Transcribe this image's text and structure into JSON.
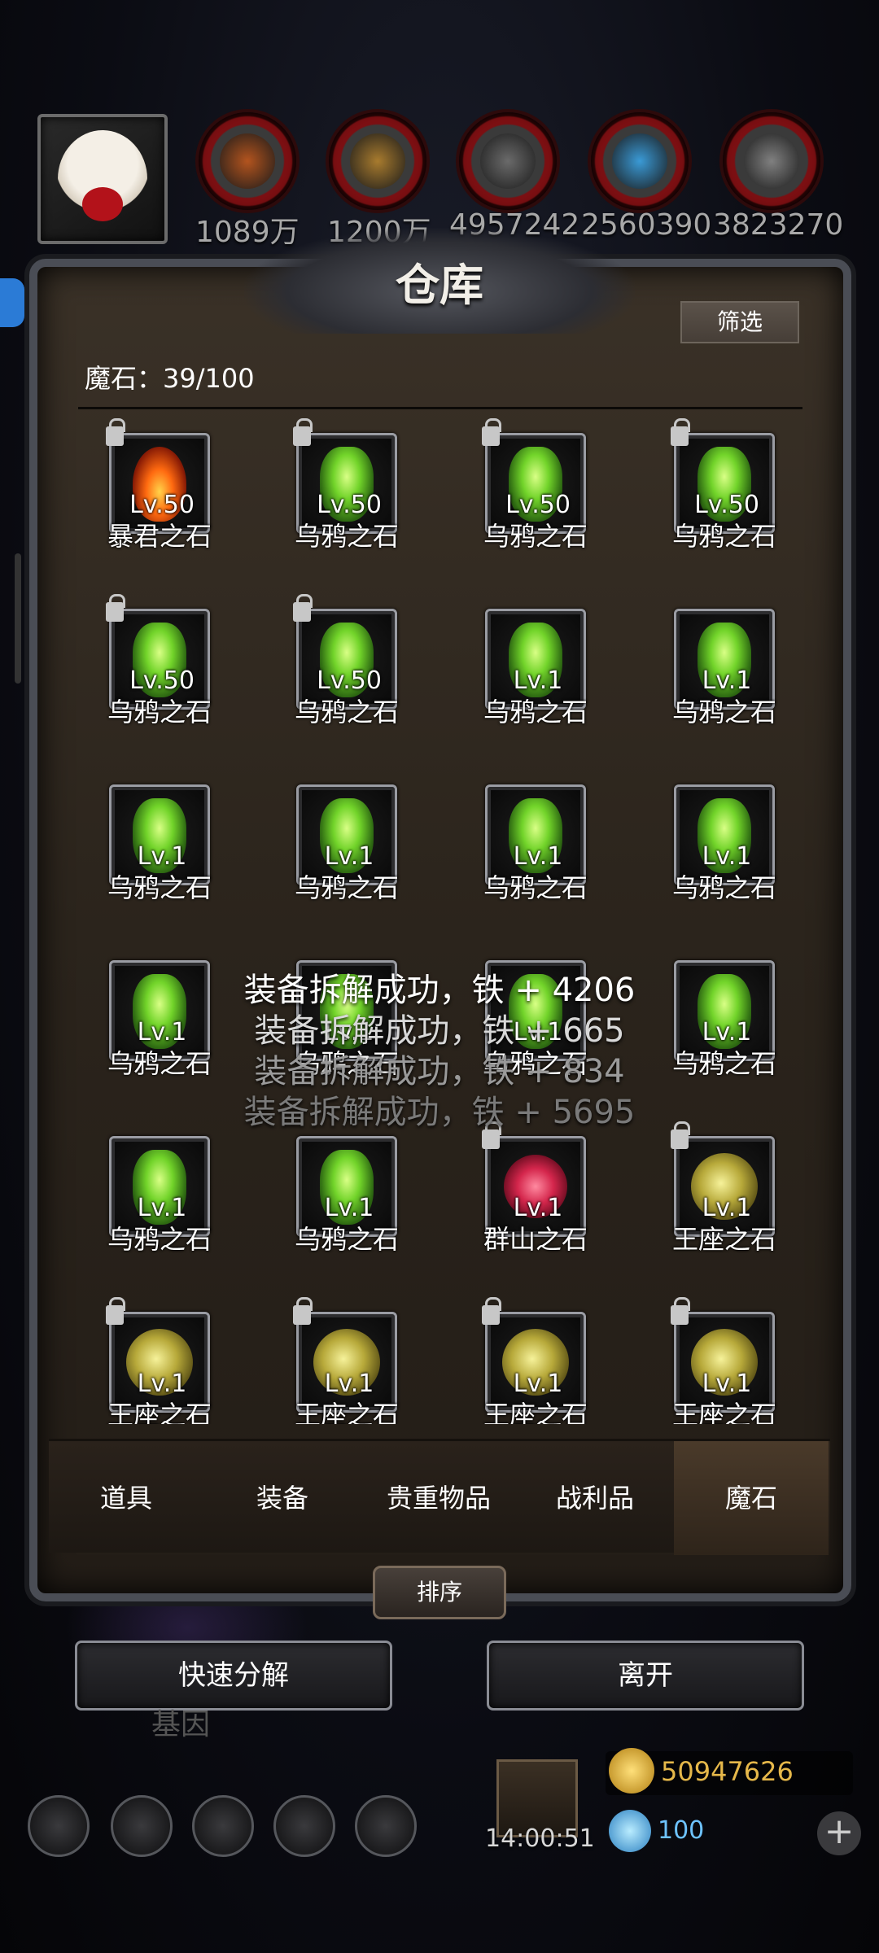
{
  "resources": [
    {
      "name": "meat",
      "value": "1089万",
      "color": "#b3541e"
    },
    {
      "name": "wood",
      "value": "1200万",
      "color": "#a87b2e"
    },
    {
      "name": "stone",
      "value": "4957242",
      "color": "#6a6a6a"
    },
    {
      "name": "crystal",
      "value": "2560390",
      "color": "#3a9ad6"
    },
    {
      "name": "iron",
      "value": "3823270",
      "color": "#808080"
    }
  ],
  "panel": {
    "title": "仓库",
    "filter_label": "筛选",
    "count_label": "魔石：39/100"
  },
  "items": [
    {
      "name": "暴君之石",
      "level": "Lv.50",
      "type": "tyrant",
      "locked": true
    },
    {
      "name": "乌鸦之石",
      "level": "Lv.50",
      "type": "crow",
      "locked": true
    },
    {
      "name": "乌鸦之石",
      "level": "Lv.50",
      "type": "crow",
      "locked": true
    },
    {
      "name": "乌鸦之石",
      "level": "Lv.50",
      "type": "crow",
      "locked": true
    },
    {
      "name": "乌鸦之石",
      "level": "Lv.50",
      "type": "crow",
      "locked": true
    },
    {
      "name": "乌鸦之石",
      "level": "Lv.50",
      "type": "crow",
      "locked": true
    },
    {
      "name": "乌鸦之石",
      "level": "Lv.1",
      "type": "crow",
      "locked": false
    },
    {
      "name": "乌鸦之石",
      "level": "Lv.1",
      "type": "crow",
      "locked": false
    },
    {
      "name": "乌鸦之石",
      "level": "Lv.1",
      "type": "crow",
      "locked": false
    },
    {
      "name": "乌鸦之石",
      "level": "Lv.1",
      "type": "crow",
      "locked": false
    },
    {
      "name": "乌鸦之石",
      "level": "Lv.1",
      "type": "crow",
      "locked": false
    },
    {
      "name": "乌鸦之石",
      "level": "Lv.1",
      "type": "crow",
      "locked": false
    },
    {
      "name": "乌鸦之石",
      "level": "Lv.1",
      "type": "crow",
      "locked": false
    },
    {
      "name": "乌鸦之石",
      "level": "Lv.1",
      "type": "crow",
      "locked": false
    },
    {
      "name": "乌鸦之石",
      "level": "Lv.1",
      "type": "crow",
      "locked": false
    },
    {
      "name": "乌鸦之石",
      "level": "Lv.1",
      "type": "crow",
      "locked": false
    },
    {
      "name": "乌鸦之石",
      "level": "Lv.1",
      "type": "crow",
      "locked": false
    },
    {
      "name": "乌鸦之石",
      "level": "Lv.1",
      "type": "crow",
      "locked": false
    },
    {
      "name": "群山之石",
      "level": "Lv.1",
      "type": "mountain",
      "locked": true
    },
    {
      "name": "王座之石",
      "level": "Lv.1",
      "type": "throne",
      "locked": true
    },
    {
      "name": "王座之石",
      "level": "Lv.1",
      "type": "throne",
      "locked": true
    },
    {
      "name": "王座之石",
      "level": "Lv.1",
      "type": "throne",
      "locked": true
    },
    {
      "name": "王座之石",
      "level": "Lv.1",
      "type": "throne",
      "locked": true
    },
    {
      "name": "王座之石",
      "level": "Lv.1",
      "type": "throne",
      "locked": true
    }
  ],
  "toasts": [
    {
      "text": "装备拆解成功，铁 + 4206",
      "color": "#ffffff"
    },
    {
      "text": "装备拆解成功，铁 + 665",
      "color": "#d8d8d8"
    },
    {
      "text": "装备拆解成功，铁 + 834",
      "color": "#9a9a9a"
    },
    {
      "text": "装备拆解成功，铁 + 5695",
      "color": "#7a7a7a"
    }
  ],
  "tabs": [
    {
      "label": "道具",
      "active": false
    },
    {
      "label": "装备",
      "active": false
    },
    {
      "label": "贵重物品",
      "active": false
    },
    {
      "label": "战利品",
      "active": false
    },
    {
      "label": "魔石",
      "active": true
    }
  ],
  "buttons": {
    "sort": "排序",
    "quick_decompose": "快速分解",
    "leave": "离开"
  },
  "hud": {
    "gold": "50947626",
    "gems": "100",
    "timer": "14:00:51",
    "player_name_partial": "基因"
  }
}
